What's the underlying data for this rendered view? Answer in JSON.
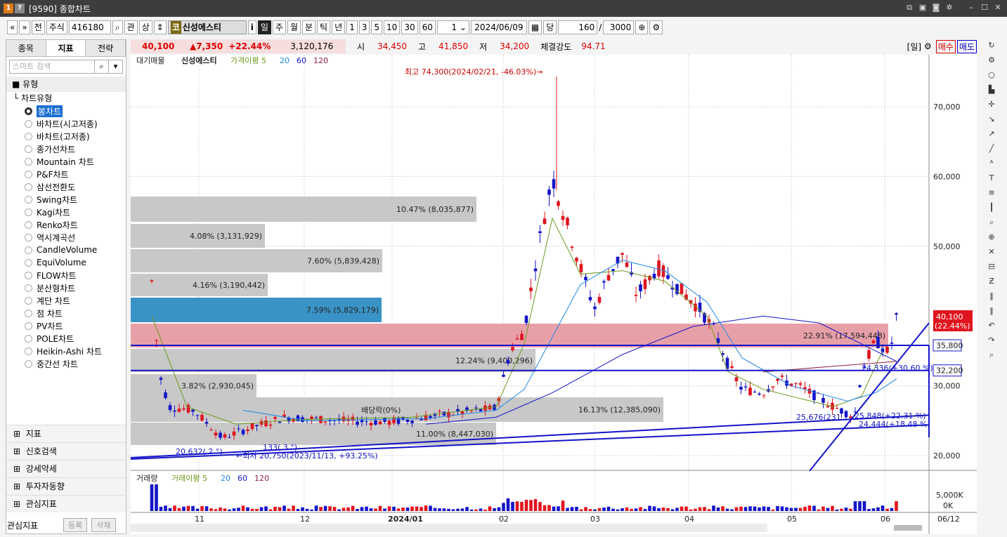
{
  "window": {
    "num1": "1",
    "num2": "?",
    "title": "[9590] 종합차트"
  },
  "toolbar": {
    "market": "주식",
    "code": "416180",
    "kwan": "관",
    "sang": "상",
    "stock_flag": "코",
    "stock_name": "신성에스티",
    "info": "i",
    "periods": [
      "일",
      "주",
      "월",
      "분",
      "틱",
      "년"
    ],
    "active_period": "일",
    "ticks": [
      "1",
      "3",
      "5",
      "10",
      "30",
      "60"
    ],
    "interval": "1",
    "date": "2024/06/09",
    "dang": "당",
    "count": "160",
    "total": "3000",
    "all": "전"
  },
  "quote": {
    "price": "40,100",
    "change": "▲7,350",
    "pct": "+22.44%",
    "volume": "3,120,176",
    "open_lbl": "시",
    "open": "34,450",
    "high_lbl": "고",
    "high": "41,850",
    "low_lbl": "저",
    "low": "34,200",
    "strength_lbl": "체결강도",
    "strength": "94.71",
    "period_tag": "[일]",
    "buy": "매수",
    "sell": "매도"
  },
  "left": {
    "tabs": [
      "종목",
      "지표",
      "전략"
    ],
    "active_tab": "지표",
    "search_ph": "스마트 검색",
    "group": "유형",
    "sub": "차트유형",
    "types": [
      "봉차트",
      "바차트(시고저종)",
      "바차트(고저종)",
      "종가선차트",
      "Mountain 차트",
      "P&F차트",
      "삼선전환도",
      "Swing차트",
      "Kagi차트",
      "Renko차트",
      "역시계곡선",
      "CandleVolume",
      "EquiVolume",
      "FLOW차트",
      "분산형차트",
      "계단 차트",
      "점 차트",
      "PV차트",
      "POLE차트",
      "Heikin-Ashi 차트",
      "중간선 차트"
    ],
    "selected_type": "봉차트",
    "sections": [
      "지표",
      "신호검색",
      "강세약세",
      "투자자동향",
      "관심지표"
    ],
    "bottom_label": "관심지표",
    "bottom_btns": [
      "등록",
      "삭제"
    ]
  },
  "chart_data": {
    "type": "candlestick",
    "legend": {
      "big": "대기매물",
      "name": "신성에스티",
      "ma_label": "가격이평 5",
      "ma": [
        "20",
        "60",
        "120"
      ]
    },
    "vol_legend": {
      "name": "거래량",
      "ma_label": "거래이평 5",
      "ma": [
        "20",
        "60",
        "120"
      ]
    },
    "y_ticks": [
      "70,000",
      "60,000",
      "50,000",
      "30,000",
      "20,000"
    ],
    "vol_ticks": [
      "5,000K",
      "0K"
    ],
    "x_ticks": [
      "11",
      "12",
      "2024/01",
      "02",
      "03",
      "04",
      "05",
      "06",
      "06/12"
    ],
    "annotations": {
      "high": "최고 74,300(2024/02/21, -46.03%)→",
      "low": "←최저 20,750(2023/11/13, +93.25%)",
      "div": "배당락(0%)",
      "last_price": "40,100",
      "last_pct": "(22.44%)",
      "line1": "35,800",
      "line2": "32,200",
      "trend1": "25,848(+22.31 %)",
      "trend2": "24,444(+18.48 %)",
      "t3": "25,676(231",
      "t4": "20,632( 2 °)",
      "t5": "133( 3 °)",
      "t6": "24,336(+30.60 %)"
    },
    "volume_profile": [
      {
        "label": "10.47% (8,035,877)",
        "pct": 10.47
      },
      {
        "label": "4.08% (3,131,929)",
        "pct": 4.08
      },
      {
        "label": "7.60% (5,839,428)",
        "pct": 7.6
      },
      {
        "label": "4.16% (3,190,442)",
        "pct": 4.16
      },
      {
        "label": "7.59% (5,829,179)",
        "pct": 7.59
      },
      {
        "label": "22.91% (17,594,448)",
        "pct": 22.91
      },
      {
        "label": "12.24% (9,400,296)",
        "pct": 12.24
      },
      {
        "label": "3.82% (2,930,045)",
        "pct": 3.82
      },
      {
        "label": "16.13% (12,385,090)",
        "pct": 16.13
      },
      {
        "label": "11.00% (8,447,030)",
        "pct": 11.0
      }
    ]
  }
}
